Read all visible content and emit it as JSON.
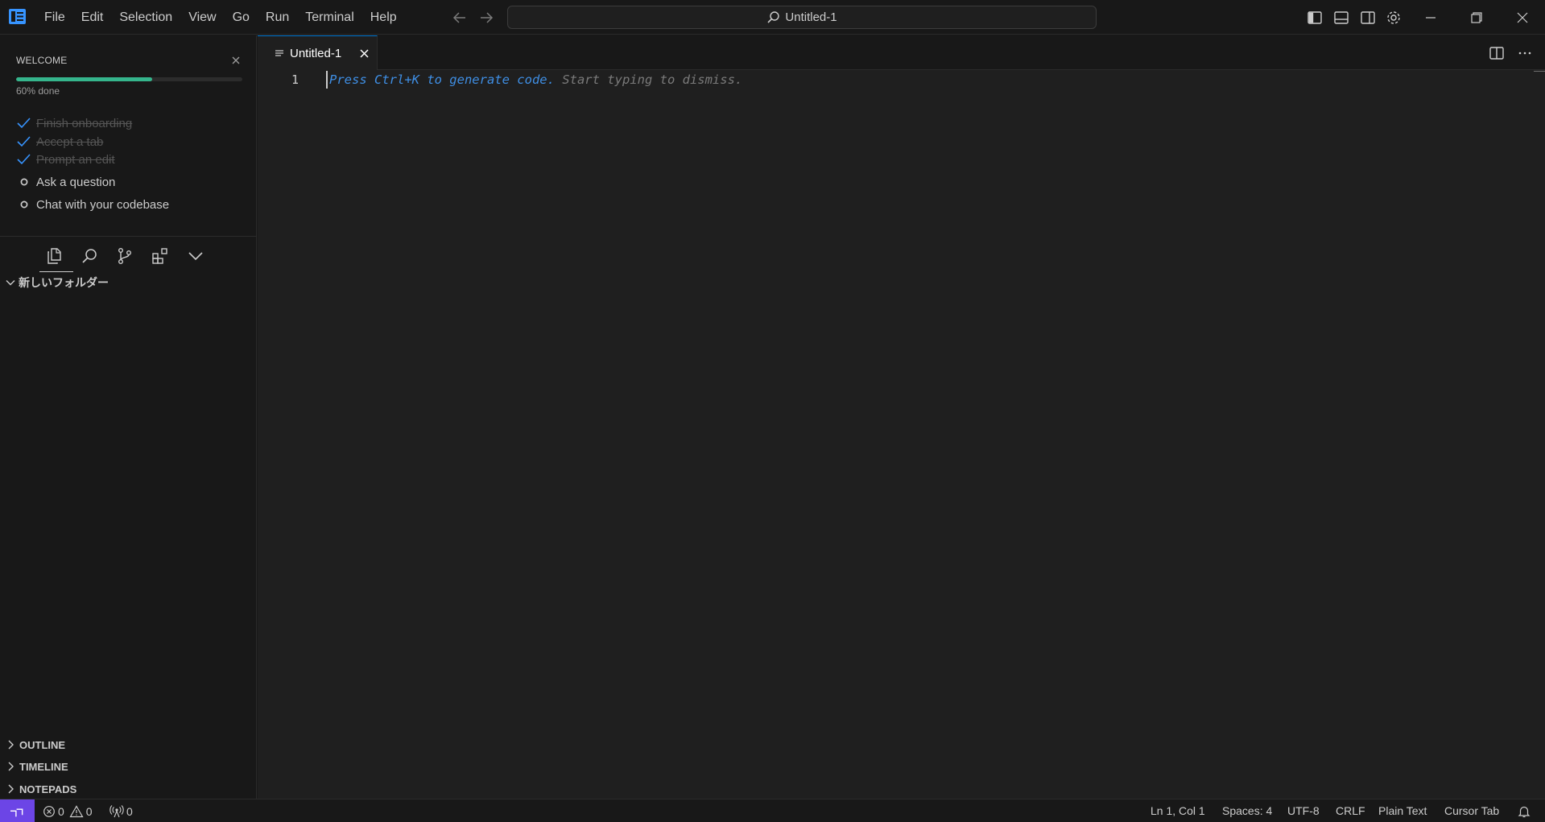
{
  "menu": [
    "File",
    "Edit",
    "Selection",
    "View",
    "Go",
    "Run",
    "Terminal",
    "Help"
  ],
  "command_center": {
    "text": "Untitled-1",
    "icon": "search-icon"
  },
  "welcome": {
    "title": "WELCOME",
    "progress_percent": 60,
    "progress_text": "60% done",
    "tasks": [
      {
        "label": "Finish onboarding",
        "done": true
      },
      {
        "label": "Accept a tab",
        "done": true
      },
      {
        "label": "Prompt an edit",
        "done": true
      },
      {
        "label": "Ask a question",
        "done": false
      },
      {
        "label": "Chat with your codebase",
        "done": false
      }
    ]
  },
  "explorer": {
    "folder": "新しいフォルダー"
  },
  "sections": [
    "OUTLINE",
    "TIMELINE",
    "NOTEPADS"
  ],
  "tab": {
    "label": "Untitled-1"
  },
  "editor": {
    "line_number": "1",
    "hint_action": "Press Ctrl+K to generate code.",
    "hint_dismiss": " Start typing to dismiss."
  },
  "status": {
    "errors": "0",
    "warnings": "0",
    "ports": "0",
    "position": "Ln 1, Col 1",
    "spaces": "Spaces: 4",
    "encoding": "UTF-8",
    "eol": "CRLF",
    "language": "Plain Text",
    "cursor_tab": "Cursor Tab"
  },
  "colors": {
    "accent": "#0078d4",
    "progress": "#35b58c",
    "remote": "#6c45e6",
    "check": "#3794ff"
  }
}
